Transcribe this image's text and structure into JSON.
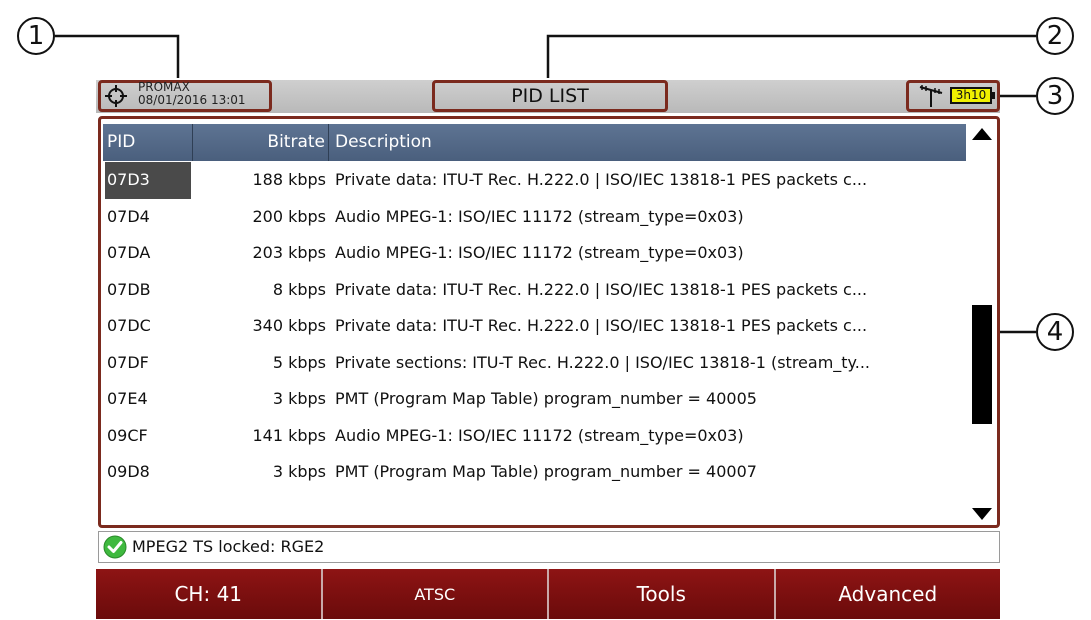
{
  "callouts": [
    "1",
    "2",
    "3",
    "4"
  ],
  "header": {
    "brand": "PROMAX",
    "datetime": "08/01/2016 13:01",
    "title": "PID LIST",
    "battery": "3h10",
    "icons": [
      "target-icon",
      "antenna-icon",
      "battery-icon"
    ]
  },
  "table": {
    "columns": [
      "PID",
      "Bitrate",
      "Description"
    ],
    "rows": [
      {
        "pid": "07D3",
        "bitrate": "188 kbps",
        "description": "Private data: ITU-T Rec. H.222.0 | ISO/IEC 13818-1 PES packets c...",
        "selected": true
      },
      {
        "pid": "07D4",
        "bitrate": "200 kbps",
        "description": "Audio MPEG-1: ISO/IEC 11172 (stream_type=0x03)"
      },
      {
        "pid": "07DA",
        "bitrate": "203 kbps",
        "description": "Audio MPEG-1: ISO/IEC 11172 (stream_type=0x03)"
      },
      {
        "pid": "07DB",
        "bitrate": "8 kbps",
        "description": "Private data: ITU-T Rec. H.222.0 | ISO/IEC 13818-1 PES packets c..."
      },
      {
        "pid": "07DC",
        "bitrate": "340 kbps",
        "description": "Private data: ITU-T Rec. H.222.0 | ISO/IEC 13818-1 PES packets c..."
      },
      {
        "pid": "07DF",
        "bitrate": "5 kbps",
        "description": "Private sections: ITU-T Rec. H.222.0 | ISO/IEC 13818-1 (stream_ty..."
      },
      {
        "pid": "07E4",
        "bitrate": "3 kbps",
        "description": "PMT (Program Map Table) program_number = 40005"
      },
      {
        "pid": "09CF",
        "bitrate": "141 kbps",
        "description": "Audio MPEG-1: ISO/IEC 11172 (stream_type=0x03)"
      },
      {
        "pid": "09D8",
        "bitrate": "3 kbps",
        "description": "PMT (Program Map Table) program_number = 40007"
      }
    ]
  },
  "status": {
    "text": "MPEG2 TS locked: RGE2",
    "icon": "check-icon"
  },
  "softkeys": [
    "CH: 41",
    "ATSC",
    "Tools",
    "Advanced"
  ],
  "colors": {
    "frame": "#7b2a1e",
    "header_row": "#4a5f7d",
    "softkey": "#7d1010",
    "battery": "#f0f000",
    "ok": "#3fb93f"
  }
}
